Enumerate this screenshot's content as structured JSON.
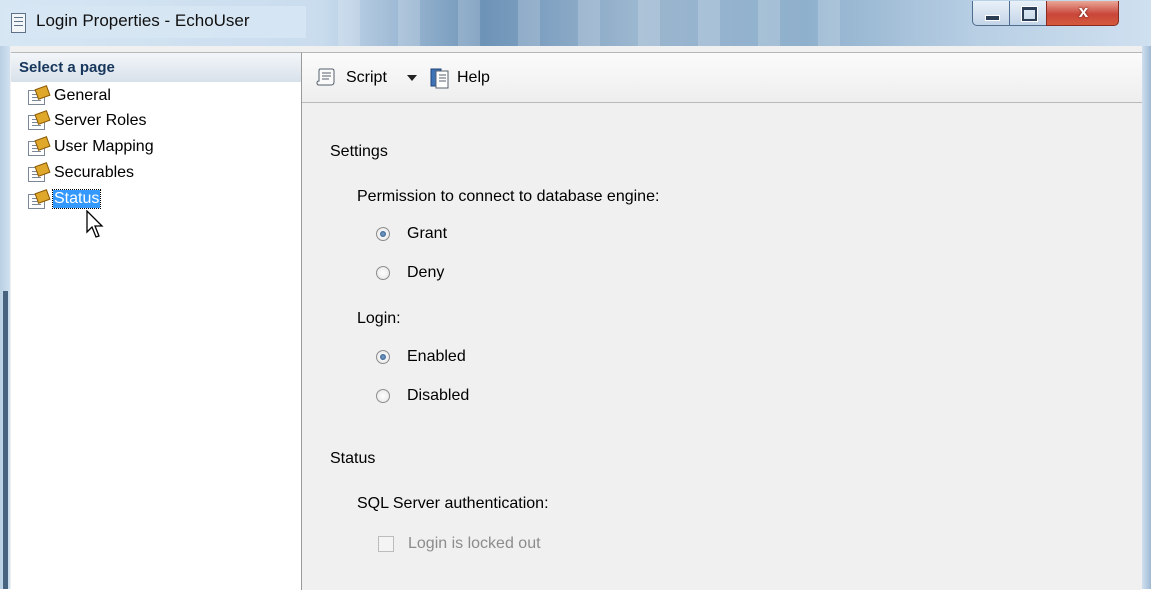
{
  "window": {
    "title": "Login Properties - EchoUser",
    "close_glyph": "x"
  },
  "left_panel": {
    "header": "Select a page",
    "items": [
      {
        "label": "General",
        "icon": "page-wand-icon"
      },
      {
        "label": "Server Roles",
        "icon": "page-wand-icon"
      },
      {
        "label": "User Mapping",
        "icon": "page-wand-icon"
      },
      {
        "label": "Securables",
        "icon": "page-wand-icon"
      },
      {
        "label": "Status",
        "icon": "page-wand-icon",
        "selected": true
      }
    ]
  },
  "toolbar": {
    "script_label": "Script",
    "help_label": "Help"
  },
  "settings": {
    "title": "Settings",
    "permission_label": "Permission to connect to database engine:",
    "grant_label": "Grant",
    "deny_label": "Deny",
    "permission_selected": "Grant",
    "login_label": "Login:",
    "enabled_label": "Enabled",
    "disabled_label": "Disabled",
    "login_selected": "Enabled"
  },
  "status": {
    "title": "Status",
    "auth_label": "SQL Server authentication:",
    "locked_out_label": "Login is locked out",
    "locked_out_checked": false,
    "locked_out_enabled": false
  },
  "colors": {
    "selection": "#3399ff",
    "header_text": "#16365b",
    "disabled_text": "#8c8c8c"
  }
}
